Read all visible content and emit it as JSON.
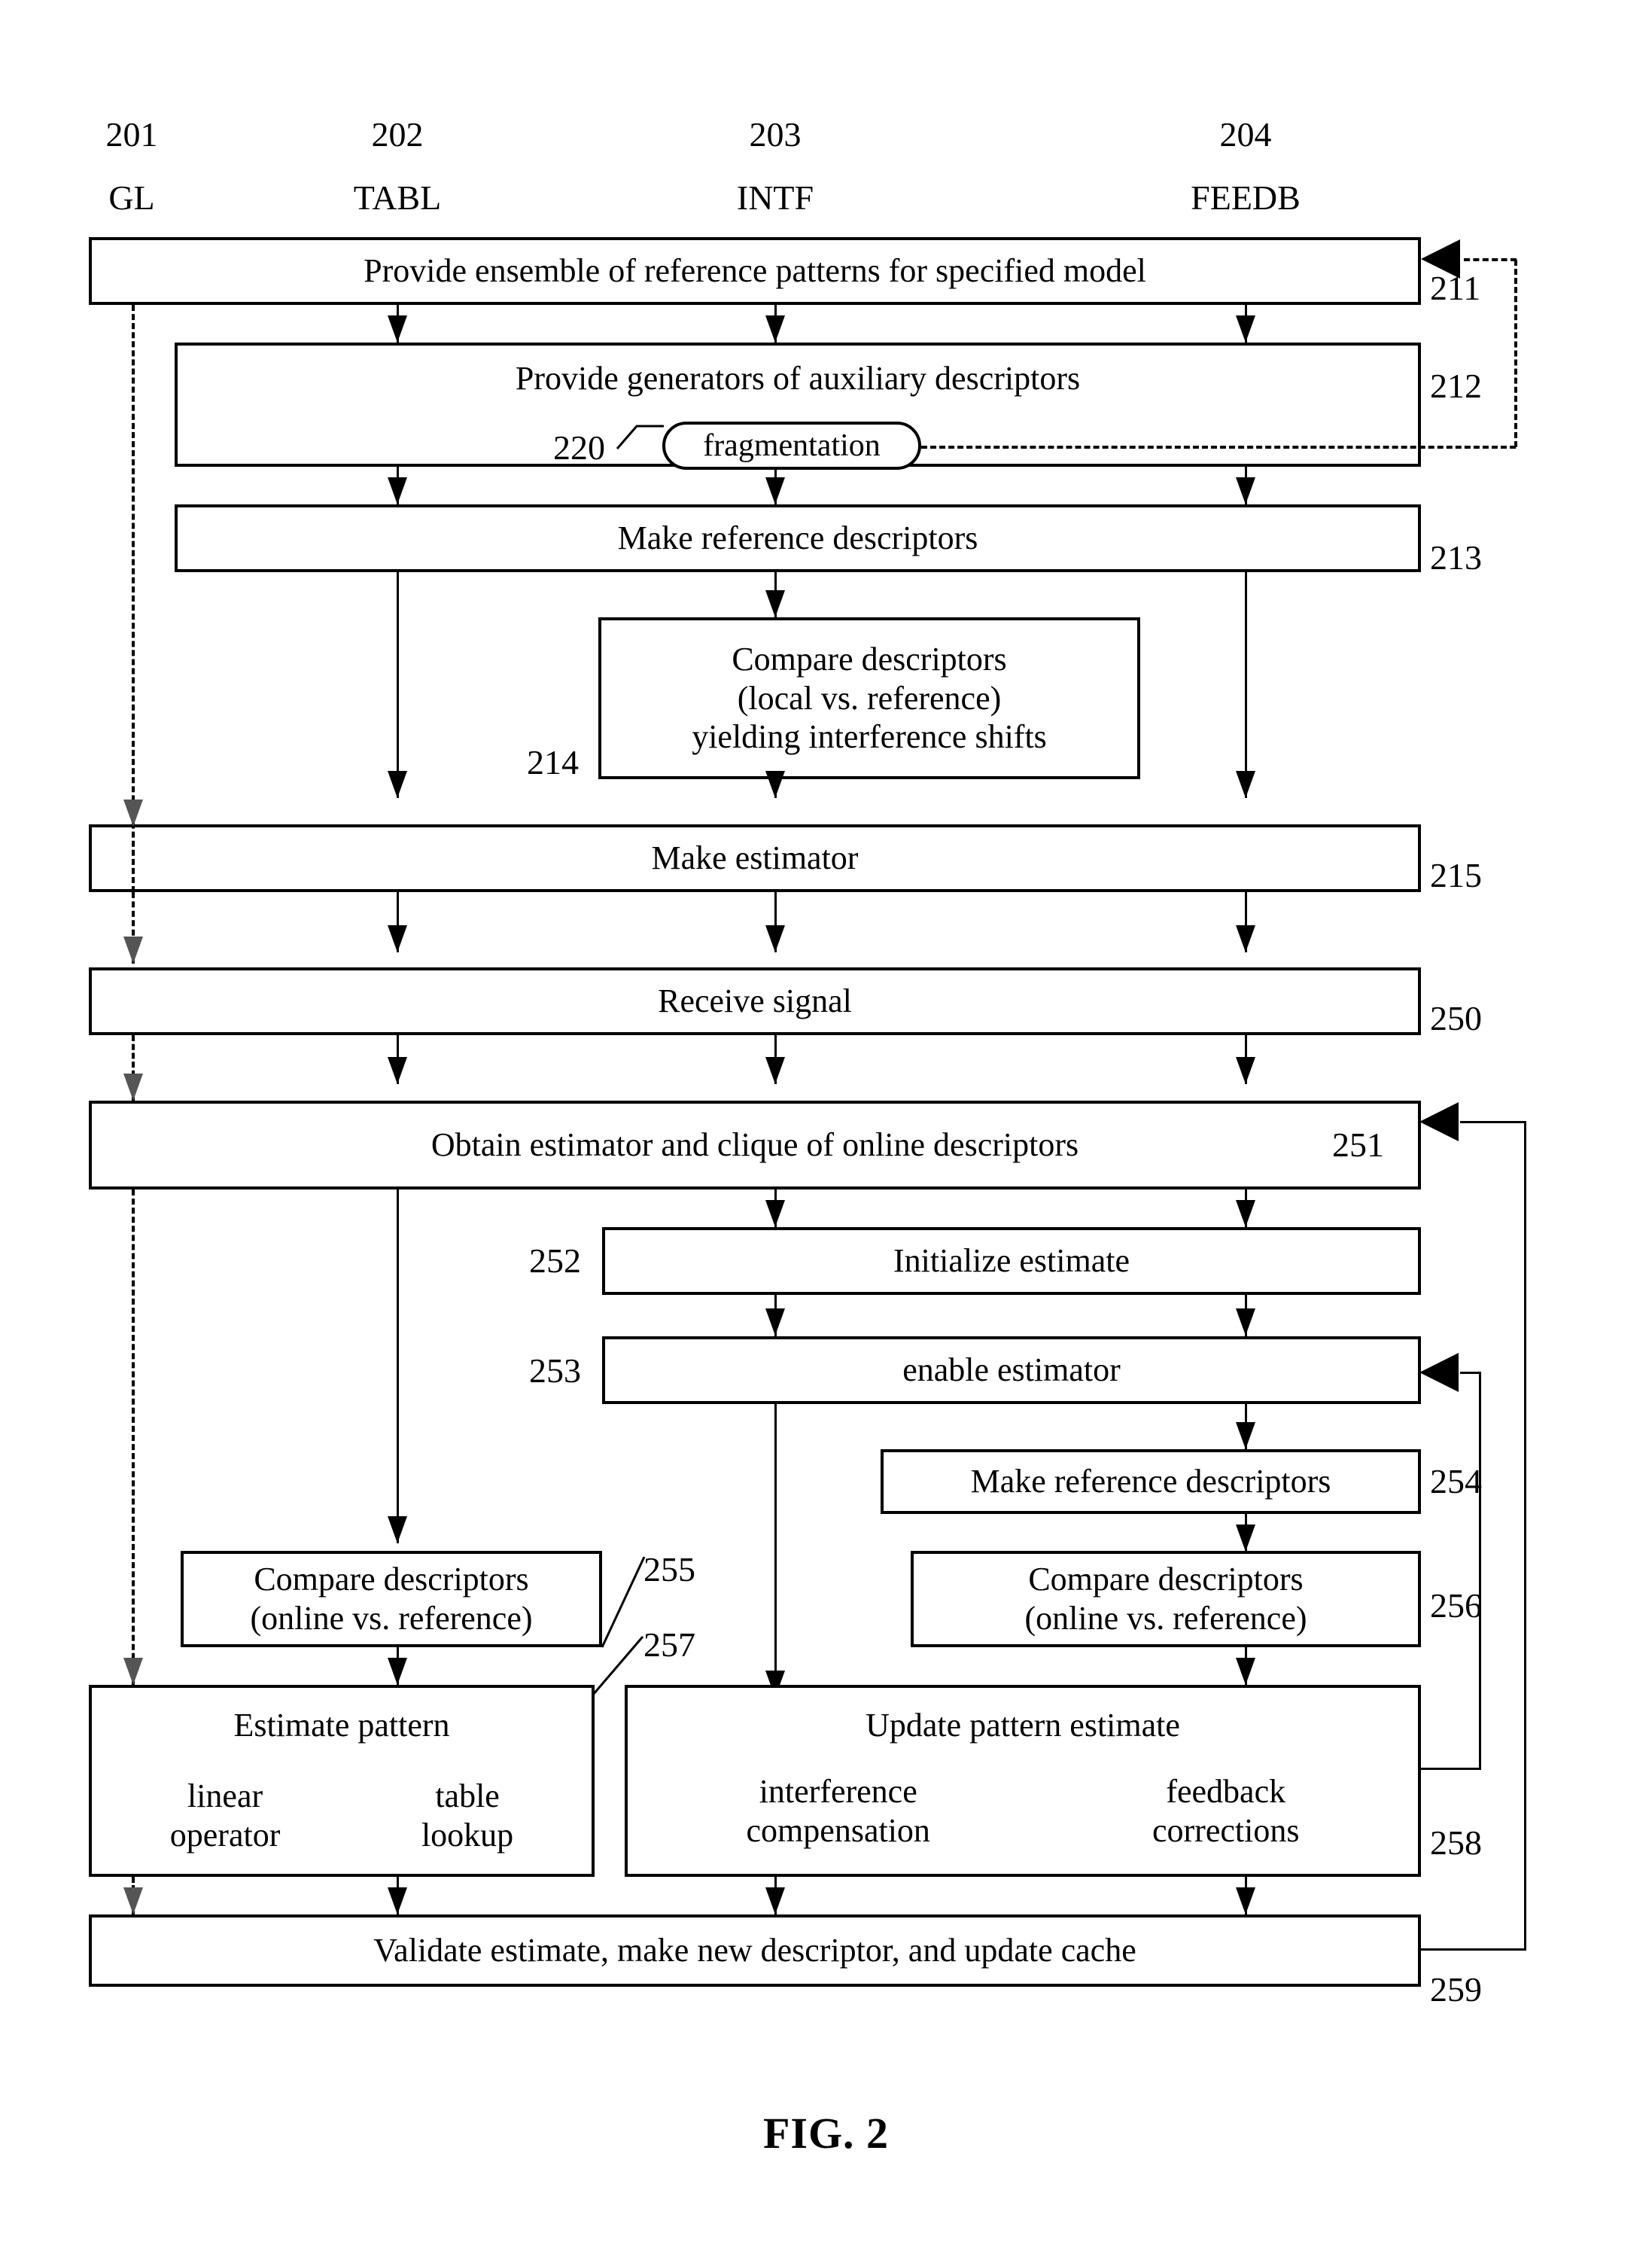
{
  "figure": {
    "caption": "FIG. 2"
  },
  "columns": [
    {
      "num": "201",
      "label": "GL"
    },
    {
      "num": "202",
      "label": "TABL"
    },
    {
      "num": "203",
      "label": "INTF"
    },
    {
      "num": "204",
      "label": "FEEDB"
    }
  ],
  "boxes": [
    {
      "ref": "211",
      "lines": [
        "Provide ensemble of reference patterns for specified model"
      ]
    },
    {
      "ref": "212",
      "lines": [
        "Provide generators of auxiliary descriptors"
      ]
    },
    {
      "ref": "213",
      "lines": [
        "Make reference descriptors"
      ]
    },
    {
      "ref": "214",
      "lines": [
        "Compare descriptors",
        "(local vs. reference)",
        "yielding interference shifts"
      ]
    },
    {
      "ref": "215",
      "lines": [
        "Make estimator"
      ]
    },
    {
      "ref": "250",
      "lines": [
        "Receive signal"
      ]
    },
    {
      "ref": "251",
      "lines": [
        "Obtain estimator and clique of online descriptors"
      ]
    },
    {
      "ref": "252",
      "lines": [
        "Initialize estimate"
      ]
    },
    {
      "ref": "253",
      "lines": [
        "enable estimator"
      ]
    },
    {
      "ref": "254",
      "lines": [
        "Make reference descriptors"
      ]
    },
    {
      "ref": "255",
      "lines": [
        "Compare descriptors",
        "(online vs. reference)"
      ]
    },
    {
      "ref": "256",
      "lines": [
        "Compare descriptors",
        "(online vs. reference)"
      ]
    },
    {
      "ref": "257",
      "lines": [
        "Estimate pattern"
      ],
      "sub_left": [
        "linear",
        "operator"
      ],
      "sub_right": [
        "table",
        "lookup"
      ]
    },
    {
      "ref": "258",
      "lines": [
        "Update pattern estimate"
      ],
      "sub_left": [
        "interference",
        "compensation"
      ],
      "sub_right": [
        "feedback",
        "corrections"
      ]
    },
    {
      "ref": "259",
      "lines": [
        "Validate estimate, make new descriptor, and update cache"
      ]
    }
  ],
  "annotations": {
    "fragmentation": {
      "ref": "220",
      "label": "fragmentation"
    }
  },
  "box_text": {
    "b211": "Provide ensemble of reference patterns for specified model",
    "b212": "Provide generators of auxiliary descriptors",
    "b213": "Make reference descriptors",
    "b214_l1": "Compare descriptors",
    "b214_l2": "(local vs. reference)",
    "b214_l3": "yielding interference shifts",
    "b215": "Make estimator",
    "b250": "Receive signal",
    "b251": "Obtain estimator and clique of online descriptors",
    "b252": "Initialize estimate",
    "b253": "enable estimator",
    "b254": "Make reference descriptors",
    "b255_l1": "Compare descriptors",
    "b255_l2": "(online vs. reference)",
    "b256_l1": "Compare descriptors",
    "b256_l2": "(online vs. reference)",
    "b257_title": "Estimate pattern",
    "b257_sub_l1": "linear",
    "b257_sub_l2": "operator",
    "b257_sub_r1": "table",
    "b257_sub_r2": "lookup",
    "b258_title": "Update pattern estimate",
    "b258_sub_l1": "interference",
    "b258_sub_l2": "compensation",
    "b258_sub_r1": "feedback",
    "b258_sub_r2": "corrections",
    "b259": "Validate estimate, make new descriptor, and update cache"
  },
  "refs": {
    "r211": "211",
    "r212": "212",
    "r213": "213",
    "r214": "214",
    "r215": "215",
    "r220": "220",
    "r250": "250",
    "r251": "251",
    "r252": "252",
    "r253": "253",
    "r254": "254",
    "r255": "255",
    "r256": "256",
    "r257": "257",
    "r258": "258",
    "r259": "259",
    "frag": "fragmentation"
  },
  "colors": {
    "ink": "#000000",
    "paper": "#ffffff"
  }
}
